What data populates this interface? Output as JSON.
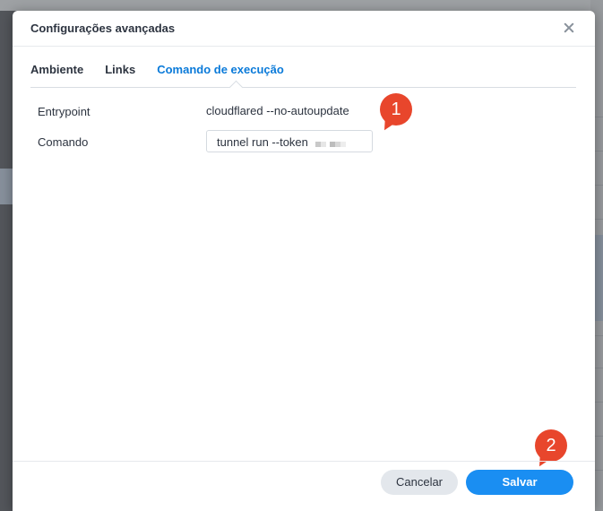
{
  "dialog": {
    "title": "Configurações avançadas",
    "tabs": [
      {
        "label": "Ambiente",
        "active": false
      },
      {
        "label": "Links",
        "active": false
      },
      {
        "label": "Comando de execução",
        "active": true
      }
    ],
    "fields": {
      "entrypoint": {
        "label": "Entrypoint",
        "value": "cloudflared --no-autoupdate"
      },
      "command": {
        "label": "Comando",
        "value": "tunnel run --token",
        "value_obscured": true
      }
    },
    "footer": {
      "cancel_label": "Cancelar",
      "save_label": "Salvar"
    }
  },
  "annotations": [
    {
      "number": "1",
      "color": "#e8462c"
    },
    {
      "number": "2",
      "color": "#e8462c"
    }
  ],
  "colors": {
    "accent": "#0a7ad9",
    "primary_button": "#1a8ef2",
    "annotation": "#e8462c"
  },
  "icons": {
    "close": "close-icon"
  }
}
